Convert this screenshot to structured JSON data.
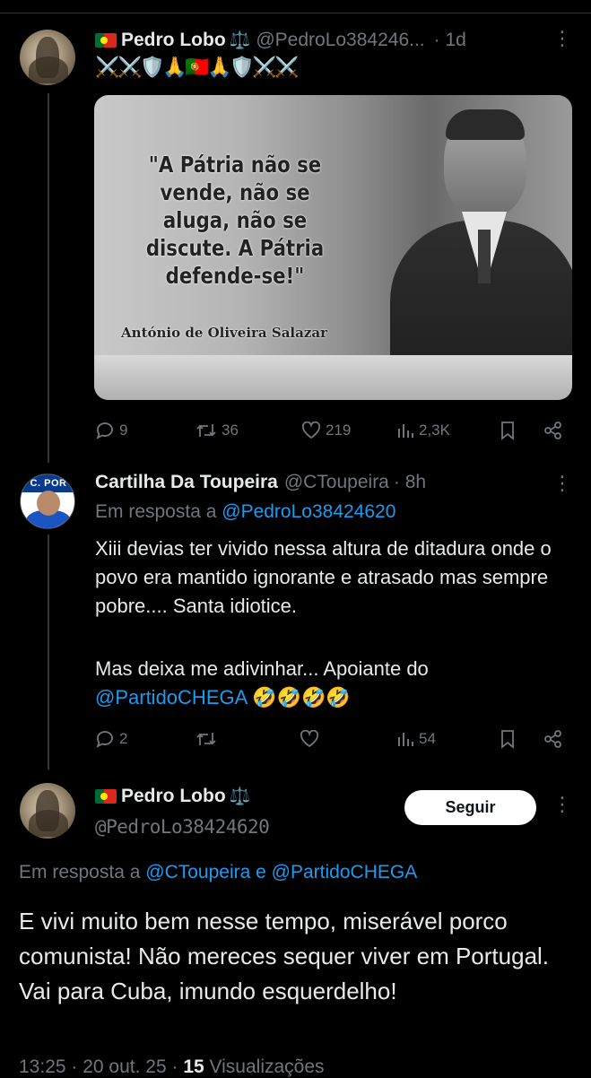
{
  "post1": {
    "name": "Pedro Lobo",
    "scales": "⚖️",
    "handle": "@PedroLo384246...",
    "time": "· 1d",
    "emoji": [
      "⚔️",
      "⚔️",
      "🛡️",
      "🙏",
      "🇵🇹",
      "🙏",
      "🛡️",
      "⚔️",
      "⚔️"
    ],
    "image": {
      "quote": "\"A Pátria não se vende, não se aluga, não se discute. A Pátria defende-se!\"",
      "author": "António de Oliveira Salazar"
    },
    "stats": {
      "replies": "9",
      "reposts": "36",
      "likes": "219",
      "views": "2,3K"
    }
  },
  "post2": {
    "avatar_text": "C. POR",
    "name": "Cartilha Da Toupeira",
    "handle": "@CToupeira",
    "time": "· 8h",
    "reply_prefix": "Em resposta a",
    "reply_to": "@PedroLo38424620",
    "text1": "Xiii devias ter vivido nessa altura de ditadura onde o povo era mantido ignorante e atrasado mas sempre pobre.... Santa idiotice.",
    "text2": "Mas deixa me adivinhar... Apoiante do",
    "mention": "@PartidoCHEGA",
    "emoji": "🤣🤣🤣🤣",
    "stats": {
      "replies": "2",
      "reposts": "",
      "likes": "",
      "views": "54"
    }
  },
  "post3": {
    "name": "Pedro Lobo",
    "scales": "⚖️",
    "handle": "@PedroLo38424620",
    "follow_label": "Seguir",
    "reply_prefix": "Em resposta a",
    "reply_to_1": "@CToupeira",
    "reply_joiner": "e",
    "reply_to_2": "@PartidoCHEGA",
    "text": "E vivi muito bem nesse tempo, miserável porco comunista! Não mereces sequer viver em Portugal. Vai para Cuba, imundo esquerdelho!",
    "timestamp": "13:25 · 20 out. 25 ·",
    "views_count": "15",
    "views_label": "Visualizações"
  },
  "colors": {
    "link": "#1d9bf0",
    "muted": "#71767b",
    "text": "#e7e9ea",
    "background": "#000000"
  }
}
